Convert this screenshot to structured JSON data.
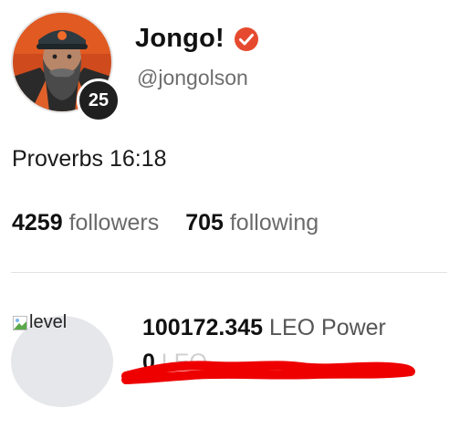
{
  "profile": {
    "display_name": "Jongo!",
    "username": "@jongolson",
    "reputation": "25",
    "bio": "Proverbs 16:18",
    "verified_color": "#e64a2e"
  },
  "stats": {
    "followers_count": "4259",
    "followers_label": "followers",
    "following_count": "705",
    "following_label": "following"
  },
  "level": {
    "image_alt": "level"
  },
  "tokens": {
    "power_value": "100172.345",
    "power_label": "LEO Power",
    "second_value": "0",
    "second_label": "LEO"
  },
  "redaction_color": "#ee0000"
}
